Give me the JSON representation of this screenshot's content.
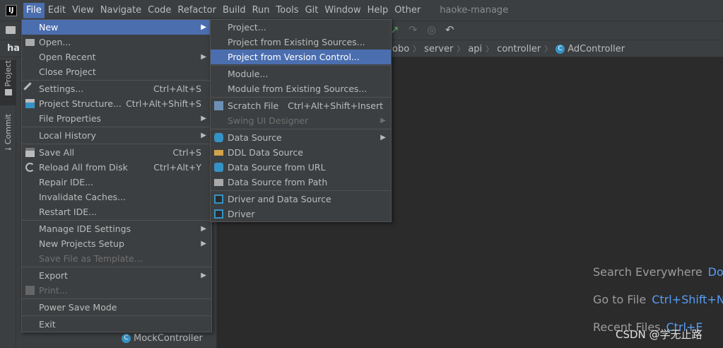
{
  "menubar": {
    "logo": "IJ",
    "items": [
      "File",
      "Edit",
      "View",
      "Navigate",
      "Code",
      "Refactor",
      "Build",
      "Run",
      "Tools",
      "Git",
      "Window",
      "Help",
      "Other"
    ],
    "project_title": "haoke-manage"
  },
  "navbar": {
    "project_badge": "ha",
    "breadcrumb": [
      "obo",
      "server",
      "api",
      "controller",
      "AdController"
    ]
  },
  "left_stripe": {
    "project_tab": "Project",
    "commit_tab": "Commit"
  },
  "project_tree": {
    "visible_item": "MockController"
  },
  "file_menu": {
    "items": [
      {
        "label": "New",
        "submenu": true,
        "selected": true
      },
      {
        "label": "Open...",
        "icon": "folder-icon"
      },
      {
        "label": "Open Recent",
        "submenu": true
      },
      {
        "label": "Close Project"
      },
      {
        "label": "Settings...",
        "shortcut": "Ctrl+Alt+S",
        "icon": "wrench-icon"
      },
      {
        "label": "Project Structure...",
        "shortcut": "Ctrl+Alt+Shift+S",
        "icon": "project-structure-icon"
      },
      {
        "label": "File Properties",
        "submenu": true
      },
      {
        "label": "Local History",
        "submenu": true
      },
      {
        "label": "Save All",
        "shortcut": "Ctrl+S",
        "icon": "save-icon"
      },
      {
        "label": "Reload All from Disk",
        "shortcut": "Ctrl+Alt+Y",
        "icon": "reload-icon"
      },
      {
        "label": "Repair IDE..."
      },
      {
        "label": "Invalidate Caches..."
      },
      {
        "label": "Restart IDE..."
      },
      {
        "label": "Manage IDE Settings",
        "submenu": true
      },
      {
        "label": "New Projects Setup",
        "submenu": true
      },
      {
        "label": "Save File as Template...",
        "disabled": true
      },
      {
        "label": "Export",
        "submenu": true
      },
      {
        "label": "Print...",
        "disabled": true,
        "icon": "print-icon"
      },
      {
        "label": "Power Save Mode"
      },
      {
        "label": "Exit"
      }
    ]
  },
  "new_menu": {
    "items": [
      {
        "label": "Project..."
      },
      {
        "label": "Project from Existing Sources..."
      },
      {
        "label": "Project from Version Control...",
        "selected": true
      },
      {
        "label": "Module..."
      },
      {
        "label": "Module from Existing Sources..."
      },
      {
        "label": "Scratch File",
        "shortcut": "Ctrl+Alt+Shift+Insert",
        "icon": "scratch-file-icon"
      },
      {
        "label": "Swing UI Designer",
        "submenu": true,
        "disabled": true
      },
      {
        "label": "Data Source",
        "submenu": true,
        "icon": "database-icon"
      },
      {
        "label": "DDL Data Source",
        "icon": "ddl-icon"
      },
      {
        "label": "Data Source from URL",
        "icon": "url-icon"
      },
      {
        "label": "Data Source from Path",
        "icon": "folder-icon"
      },
      {
        "label": "Driver and Data Source",
        "icon": "driver-icon"
      },
      {
        "label": "Driver",
        "icon": "driver-icon"
      }
    ]
  },
  "editor_hints": [
    {
      "label": "Search Everywhere",
      "shortcut": "Dou"
    },
    {
      "label": "Go to File",
      "shortcut": "Ctrl+Shift+N"
    },
    {
      "label": "Recent Files",
      "shortcut": "Ctrl+E"
    }
  ],
  "watermark": "CSDN @学无止路",
  "colors": {
    "selection": "#4b6eaf",
    "background": "#2b2b2b",
    "panel": "#3c3f41",
    "shortcut_blue": "#589df6"
  }
}
